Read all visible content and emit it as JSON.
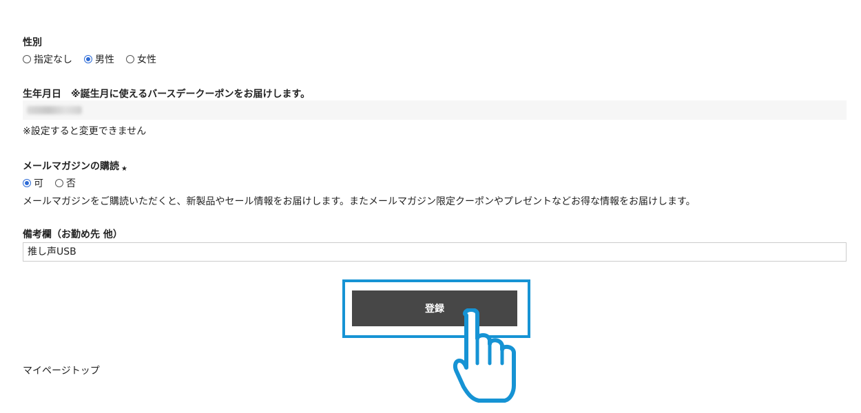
{
  "gender": {
    "label": "性別",
    "options": [
      {
        "label": "指定なし",
        "selected": false
      },
      {
        "label": "男性",
        "selected": true
      },
      {
        "label": "女性",
        "selected": false
      }
    ]
  },
  "birthday": {
    "label": "生年月日　※誕生月に使えるバースデークーポンをお届けします。",
    "note": "※設定すると変更できません"
  },
  "newsletter": {
    "label": "メールマガジンの購読",
    "required_mark": "★",
    "options": [
      {
        "label": "可",
        "selected": true
      },
      {
        "label": "否",
        "selected": false
      }
    ],
    "description": "メールマガジンをご購読いただくと、新製品やセール情報をお届けします。またメールマガジン限定クーポンやプレゼントなどお得な情報をお届けします。"
  },
  "remarks": {
    "label": "備考欄（お勤め先 他）",
    "value": "推し声USB"
  },
  "submit_label": "登録",
  "footer_link": "マイページトップ",
  "colors": {
    "accent_highlight": "#1693d4",
    "button_bg": "#474747",
    "radio_selected": "#2d6bd6"
  }
}
